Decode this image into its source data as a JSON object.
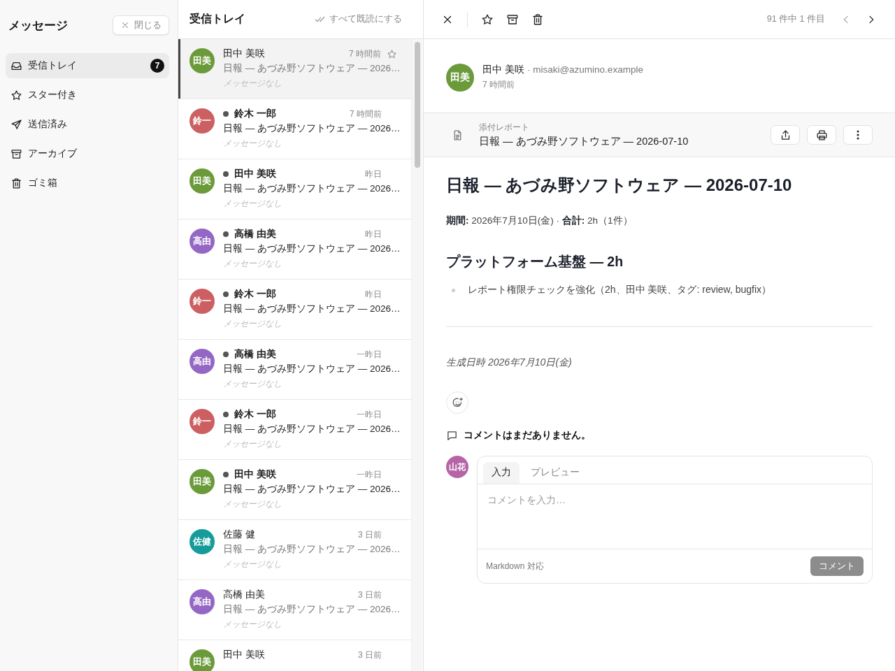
{
  "sidebar": {
    "title": "メッセージ",
    "close_button": "閉じる",
    "items": [
      {
        "label": "受信トレイ",
        "badge": "7",
        "selected": true
      },
      {
        "label": "スター付き",
        "selected": false
      },
      {
        "label": "送信済み",
        "selected": false
      },
      {
        "label": "アーカイブ",
        "selected": false
      },
      {
        "label": "ゴミ箱",
        "selected": false
      }
    ]
  },
  "message_list": {
    "title": "受信トレイ",
    "mark_all_read": "すべて既読にする",
    "messages": [
      {
        "initials": "田美",
        "color": "#6b9a3b",
        "sender": "田中 美咲",
        "time": "7 時間前",
        "subject": "日報 — あづみ野ソフトウェア — 2026…",
        "preview": "メッセージなし",
        "unread": false,
        "selected": true
      },
      {
        "initials": "鈴一",
        "color": "#cc5f62",
        "sender": "鈴木 一郎",
        "time": "7 時間前",
        "subject": "日報 — あづみ野ソフトウェア — 2026…",
        "preview": "メッセージなし",
        "unread": true,
        "selected": false
      },
      {
        "initials": "田美",
        "color": "#6b9a3b",
        "sender": "田中 美咲",
        "time": "昨日",
        "subject": "日報 — あづみ野ソフトウェア — 2026…",
        "preview": "メッセージなし",
        "unread": true,
        "selected": false
      },
      {
        "initials": "高由",
        "color": "#9567c4",
        "sender": "高橋 由美",
        "time": "昨日",
        "subject": "日報 — あづみ野ソフトウェア — 2026…",
        "preview": "メッセージなし",
        "unread": true,
        "selected": false
      },
      {
        "initials": "鈴一",
        "color": "#cc5f62",
        "sender": "鈴木 一郎",
        "time": "昨日",
        "subject": "日報 — あづみ野ソフトウェア — 2026…",
        "preview": "メッセージなし",
        "unread": true,
        "selected": false
      },
      {
        "initials": "高由",
        "color": "#9567c4",
        "sender": "高橋 由美",
        "time": "一昨日",
        "subject": "日報 — あづみ野ソフトウェア — 2026…",
        "preview": "メッセージなし",
        "unread": true,
        "selected": false
      },
      {
        "initials": "鈴一",
        "color": "#cc5f62",
        "sender": "鈴木 一郎",
        "time": "一昨日",
        "subject": "日報 — あづみ野ソフトウェア — 2026…",
        "preview": "メッセージなし",
        "unread": true,
        "selected": false
      },
      {
        "initials": "田美",
        "color": "#6b9a3b",
        "sender": "田中 美咲",
        "time": "一昨日",
        "subject": "日報 — あづみ野ソフトウェア — 2026…",
        "preview": "メッセージなし",
        "unread": true,
        "selected": false
      },
      {
        "initials": "佐健",
        "color": "#159c9a",
        "sender": "佐藤 健",
        "time": "3 日前",
        "subject": "日報 — あづみ野ソフトウェア — 2026…",
        "preview": "メッセージなし",
        "unread": false,
        "selected": false
      },
      {
        "initials": "高由",
        "color": "#9567c4",
        "sender": "高橋 由美",
        "time": "3 日前",
        "subject": "日報 — あづみ野ソフトウェア — 2026…",
        "preview": "メッセージなし",
        "unread": false,
        "selected": false
      },
      {
        "initials": "田美",
        "color": "#6b9a3b",
        "sender": "田中 美咲",
        "time": "3 日前",
        "unread": false,
        "selected": false
      }
    ]
  },
  "detail": {
    "position": "91 件中 1 件目",
    "sender": {
      "initials": "田美",
      "color": "#6b9a3b",
      "name": "田中 美咲",
      "email": "· misaki@azumino.example",
      "time": "7 時間前"
    },
    "attachment": {
      "label": "添付レポート",
      "title": "日報 — あづみ野ソフトウェア — 2026-07-10"
    },
    "report": {
      "title": "日報 — あづみ野ソフトウェア — 2026-07-10",
      "meta": "**期間:** 2026年7月10日(金) · **合計:** 2h（1件）",
      "section_title": "プラットフォーム基盤 — 2h",
      "items": [
        "レポート権限チェックを強化（2h、田中 美咲、タグ: review, bugfix）"
      ],
      "generated": "生成日時 2026年7月10日(金)"
    },
    "comments": {
      "empty_text": "コメントはまだありません。",
      "author": {
        "initials": "山花",
        "color": "#b565a7"
      },
      "tabs": [
        {
          "label": "入力",
          "selected": true
        },
        {
          "label": "プレビュー",
          "selected": false
        }
      ],
      "placeholder": "コメントを入力…",
      "hint": "Markdown 対応",
      "submit": "コメント",
      "submit_disabled": true
    }
  }
}
